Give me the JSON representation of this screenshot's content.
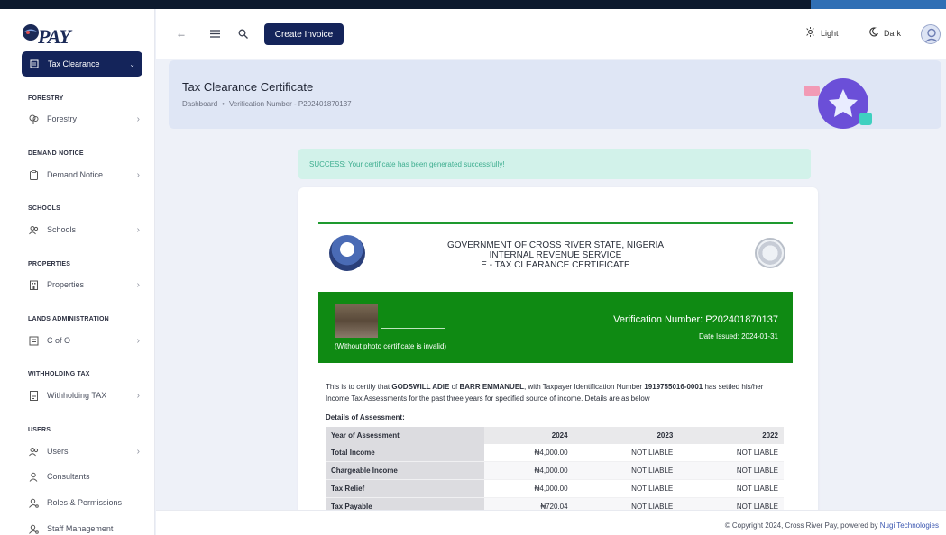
{
  "app": {
    "logo_text": "PAY"
  },
  "sidebar": {
    "active": {
      "label": "Tax Clearance",
      "icon": "receipt-icon"
    },
    "sections": [
      {
        "title": "FORESTRY",
        "items": [
          {
            "label": "Forestry",
            "icon": "tree-icon",
            "has_children": true
          }
        ]
      },
      {
        "title": "DEMAND NOTICE",
        "items": [
          {
            "label": "Demand Notice",
            "icon": "clipboard-icon",
            "has_children": true
          }
        ]
      },
      {
        "title": "SCHOOLS",
        "items": [
          {
            "label": "Schools",
            "icon": "users-icon",
            "has_children": true
          }
        ]
      },
      {
        "title": "PROPERTIES",
        "items": [
          {
            "label": "Properties",
            "icon": "building-icon",
            "has_children": true
          }
        ]
      },
      {
        "title": "LANDS ADMINISTRATION",
        "items": [
          {
            "label": "C of O",
            "icon": "receipt-icon",
            "has_children": true
          }
        ]
      },
      {
        "title": "WITHHOLDING TAX",
        "items": [
          {
            "label": "Withholding TAX",
            "icon": "document-icon",
            "has_children": true
          }
        ]
      },
      {
        "title": "USERS",
        "items": [
          {
            "label": "Users",
            "icon": "users-icon",
            "has_children": true
          },
          {
            "label": "Consultants",
            "icon": "user-icon",
            "has_children": false
          },
          {
            "label": "Roles & Permissions",
            "icon": "user-key-icon",
            "has_children": false
          },
          {
            "label": "Staff Management",
            "icon": "user-key-icon",
            "has_children": false
          }
        ]
      }
    ]
  },
  "header": {
    "create_invoice_label": "Create Invoice",
    "light_label": "Light",
    "dark_label": "Dark"
  },
  "page": {
    "title": "Tax Clearance Certificate",
    "breadcrumb": [
      "Dashboard",
      "Verification Number - P202401870137"
    ]
  },
  "alert": {
    "text": "SUCCESS: Your certificate has been generated successfully!"
  },
  "certificate": {
    "gov_lines": [
      "GOVERNMENT OF CROSS RIVER STATE, NIGERIA",
      "INTERNAL REVENUE SERVICE",
      "E - TAX CLEARANCE CERTIFICATE"
    ],
    "photo_note": "(Without photo certificate is invalid)",
    "verification": "Verification Number: P202401870137",
    "date_issued": "Date Issued: 2024-01-31",
    "body_prefix": "This is to certify that ",
    "name": "GODSWILL ADIE",
    "body_of": " of ",
    "org": "BARR EMMANUEL",
    "body_tin": ", with Taxpayer Identification Number ",
    "tin": "1919755016-0001",
    "body_suffix": " has settled his/her Income Tax Assessments for the past three years for specified source of income. Details are as below",
    "details_title": "Details of Assessment:",
    "table": {
      "headers": [
        "Year of Assessment",
        "2024",
        "2023",
        "2022"
      ],
      "rows": [
        [
          "Total Income",
          "₦4,000.00",
          "NOT LIABLE",
          "NOT LIABLE"
        ],
        [
          "Chargeable Income",
          "₦4,000.00",
          "NOT LIABLE",
          "NOT LIABLE"
        ],
        [
          "Tax Relief",
          "₦4,000.00",
          "NOT LIABLE",
          "NOT LIABLE"
        ],
        [
          "Tax Payable",
          "₦720.04",
          "NOT LIABLE",
          "NOT LIABLE"
        ]
      ]
    }
  },
  "footer": {
    "text": "© Copyright 2024, Cross River Pay, powered by ",
    "link": "Nugi Technologies"
  }
}
